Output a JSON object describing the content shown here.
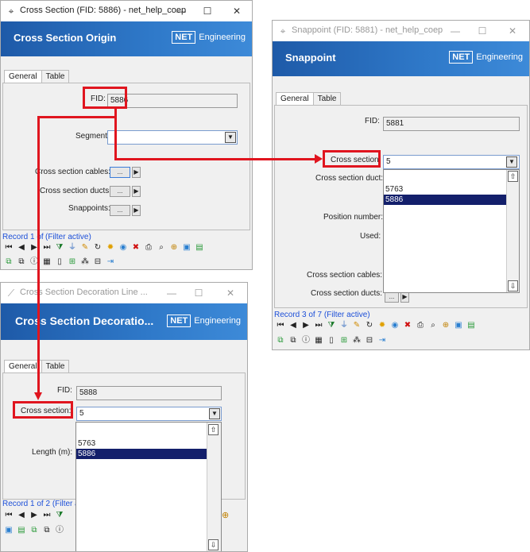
{
  "win1": {
    "title": "Cross Section (FID: 5886) - net_help_coep",
    "banner": "Cross Section Origin",
    "logo_box": "NET",
    "logo_text": "Engineering",
    "tabs": [
      "General",
      "Table"
    ],
    "fid_label": "FID:",
    "fid_value": "5886",
    "segment_label": "Segment:",
    "cables_label": "Cross section cables:",
    "ducts_label": "Cross section ducts:",
    "snappoints_label": "Snappoints:",
    "dots": "...",
    "record": "Record 1 of",
    "filter": "(Filter active)"
  },
  "win2": {
    "title": "Snappoint (FID: 5881) - net_help_coep",
    "banner": "Snappoint",
    "logo_box": "NET",
    "logo_text": "Engineering",
    "tabs": [
      "General",
      "Table"
    ],
    "fid_label": "FID:",
    "fid_value": "5881",
    "cross_section_label": "Cross section:",
    "cross_section_value": "5",
    "duct_label": "Cross section duct:",
    "position_label": "Position number:",
    "used_label": "Used:",
    "cables_label": "Cross section cables:",
    "ducts_label": "Cross section ducts:",
    "dropdown": [
      "",
      "5763",
      "5886"
    ],
    "dots": "...",
    "record": "Record 3 of 7 (Filter active)"
  },
  "win3": {
    "title": "Cross Section Decoration Line ...",
    "banner": "Cross Section Decoratio...",
    "logo_box": "NET",
    "logo_text": "Engineering",
    "tabs": [
      "General",
      "Table"
    ],
    "fid_label": "FID:",
    "fid_value": "5888",
    "cross_section_label": "Cross section:",
    "cross_section_value": "5",
    "length_label": "Length (m):",
    "dropdown": [
      "",
      "5763",
      "5886"
    ],
    "record": "Record 1 of 2 (Filter a"
  },
  "glyphs": {
    "minimize": "—",
    "maximize": "☐",
    "close": "✕",
    "combo": "▼",
    "up": "⇧",
    "down": "⇩",
    "next": "▶"
  },
  "colors": {
    "banner": "#2f79c9",
    "highlight": "#e0151f",
    "selection": "#131f6b",
    "record": "#1c4fd8"
  }
}
